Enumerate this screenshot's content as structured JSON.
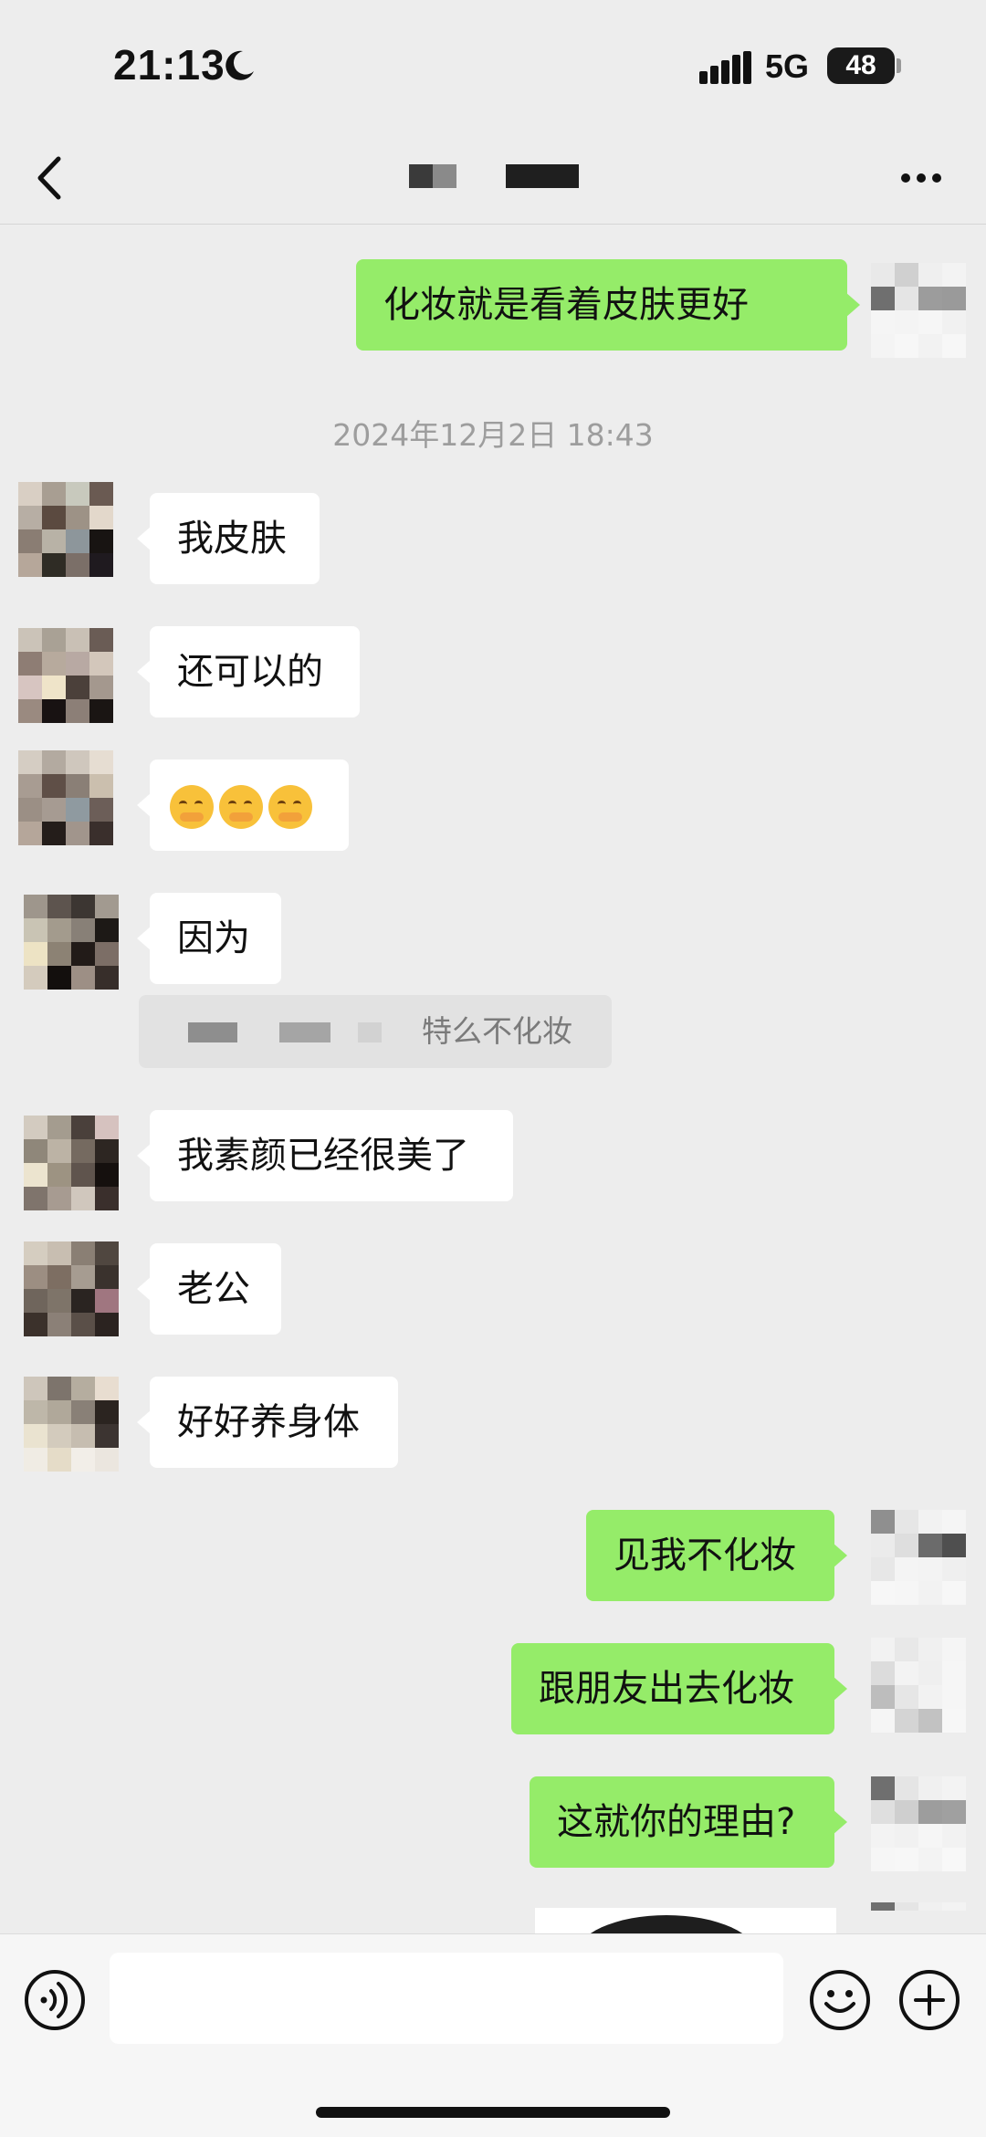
{
  "status_bar": {
    "time": "21:13",
    "network": "5G",
    "battery": "48"
  },
  "chat": {
    "timestamp": "2024年12月2日 18:43",
    "messages": [
      {
        "side": "out",
        "text": "化妆就是看着皮肤更好"
      },
      {
        "side": "in",
        "text": "我皮肤"
      },
      {
        "side": "in",
        "text": "还可以的"
      },
      {
        "side": "in",
        "text": "",
        "emoji_count": 3,
        "emoji_name": "covering-mouth-face"
      },
      {
        "side": "in",
        "text": "因为"
      },
      {
        "side": "in",
        "text": "我素颜已经很美了"
      },
      {
        "side": "in",
        "text": "老公"
      },
      {
        "side": "in",
        "text": "好好养身体"
      },
      {
        "side": "out",
        "text": "见我不化妆"
      },
      {
        "side": "out",
        "text": "跟朋友出去化妆"
      },
      {
        "side": "out",
        "text": "这就你的理由?"
      }
    ],
    "quote": {
      "text": "特么不化妆"
    }
  },
  "colors": {
    "background": "#ededed",
    "outgoing_bubble": "#95ec69",
    "incoming_bubble": "#ffffff",
    "timestamp": "#9d9d9d"
  },
  "icons": {
    "back": "back-arrow-icon",
    "more": "more-icon",
    "voice": "voice-icon",
    "emoji": "emoji-icon",
    "plus": "plus-icon"
  }
}
